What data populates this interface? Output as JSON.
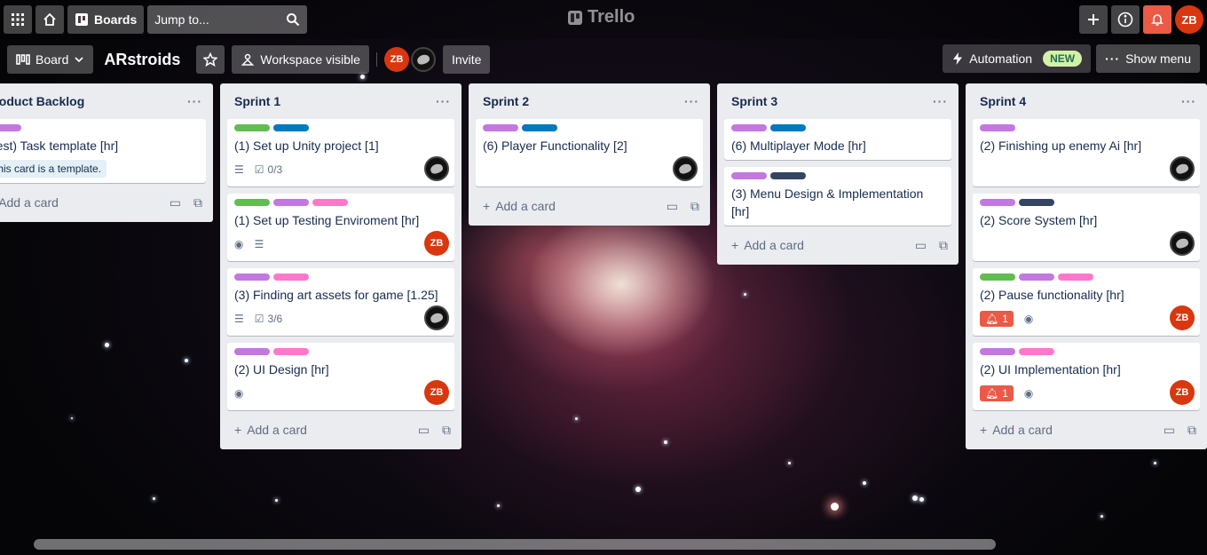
{
  "topbar": {
    "boards_label": "Boards",
    "search_placeholder": "Jump to...",
    "logo_text": "Trello",
    "user_initials": "ZB"
  },
  "board": {
    "view_label": "Board",
    "title": "ARstroids",
    "visibility_label": "Workspace visible",
    "invite_label": "Invite",
    "automation_label": "Automation",
    "new_badge": "NEW",
    "show_menu_label": "Show menu",
    "member_initials": "ZB"
  },
  "colors": {
    "green": "#61bd4f",
    "blue": "#0079bf",
    "purple": "#c377e0",
    "pink": "#ff78cb",
    "navy": "#344563",
    "avatar_red": "#d9370f"
  },
  "add_card_label": "Add a card",
  "lists": [
    {
      "title": "Product Backlog",
      "cards": [
        {
          "title": "(Test) Task template [hr]",
          "template_label": "This card is a template."
        }
      ]
    },
    {
      "title": "Sprint 1",
      "cards": [
        {
          "title": "(1) Set up Unity project [1]",
          "checklist": "0/3"
        },
        {
          "title": "(1) Set up Testing Enviroment [hr]"
        },
        {
          "title": "(3) Finding art assets for game [1.25]",
          "checklist": "3/6"
        },
        {
          "title": "(2) UI Design [hr]"
        }
      ]
    },
    {
      "title": "Sprint 2",
      "cards": [
        {
          "title": "(6) Player Functionality [2]"
        }
      ]
    },
    {
      "title": "Sprint 3",
      "cards": [
        {
          "title": "(6) Multiplayer Mode [hr]"
        },
        {
          "title": "(3) Menu Design & Implementation [hr]"
        }
      ]
    },
    {
      "title": "Sprint 4",
      "cards": [
        {
          "title": "(2) Finishing up enemy Ai [hr]"
        },
        {
          "title": "(2) Score System [hr]"
        },
        {
          "title": "(2) Pause functionality [hr]",
          "notifications": "1"
        },
        {
          "title": "(2) UI Implementation [hr]",
          "notifications": "1"
        }
      ]
    }
  ]
}
